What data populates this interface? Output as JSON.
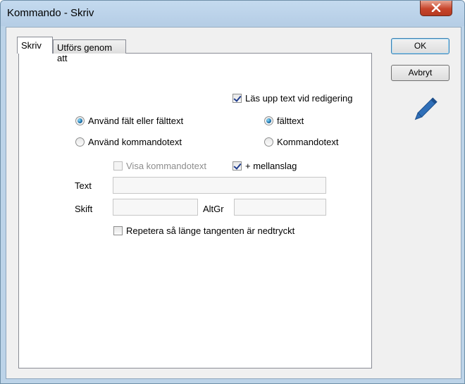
{
  "window": {
    "title": "Kommando - Skriv"
  },
  "tabs": [
    {
      "label": "Skriv",
      "active": true
    },
    {
      "label": "Utförs genom att",
      "active": false
    }
  ],
  "buttons": {
    "ok": "OK",
    "cancel": "Avbryt"
  },
  "options": {
    "read_aloud": {
      "label": "Läs upp text vid redigering",
      "checked": true
    },
    "use_field": {
      "label": "Använd fält eller fälttext",
      "selected": true
    },
    "use_command": {
      "label": "Använd kommandotext",
      "selected": false
    },
    "field_text": {
      "label": "fälttext",
      "selected": true
    },
    "command_text": {
      "label": "Kommandotext",
      "selected": false
    },
    "show_command": {
      "label": "Visa kommandotext",
      "checked": false,
      "disabled": true
    },
    "plus_space": {
      "label": "+ mellanslag",
      "checked": true
    },
    "repeat": {
      "label": "Repetera så länge tangenten är nedtryckt",
      "checked": false
    }
  },
  "fields": {
    "text": {
      "label": "Text",
      "value": ""
    },
    "shift": {
      "label": "Skift",
      "value": ""
    },
    "altgr": {
      "label": "AltGr",
      "value": ""
    }
  },
  "icons": {
    "close": "close-icon",
    "pencil": "pencil-icon"
  }
}
